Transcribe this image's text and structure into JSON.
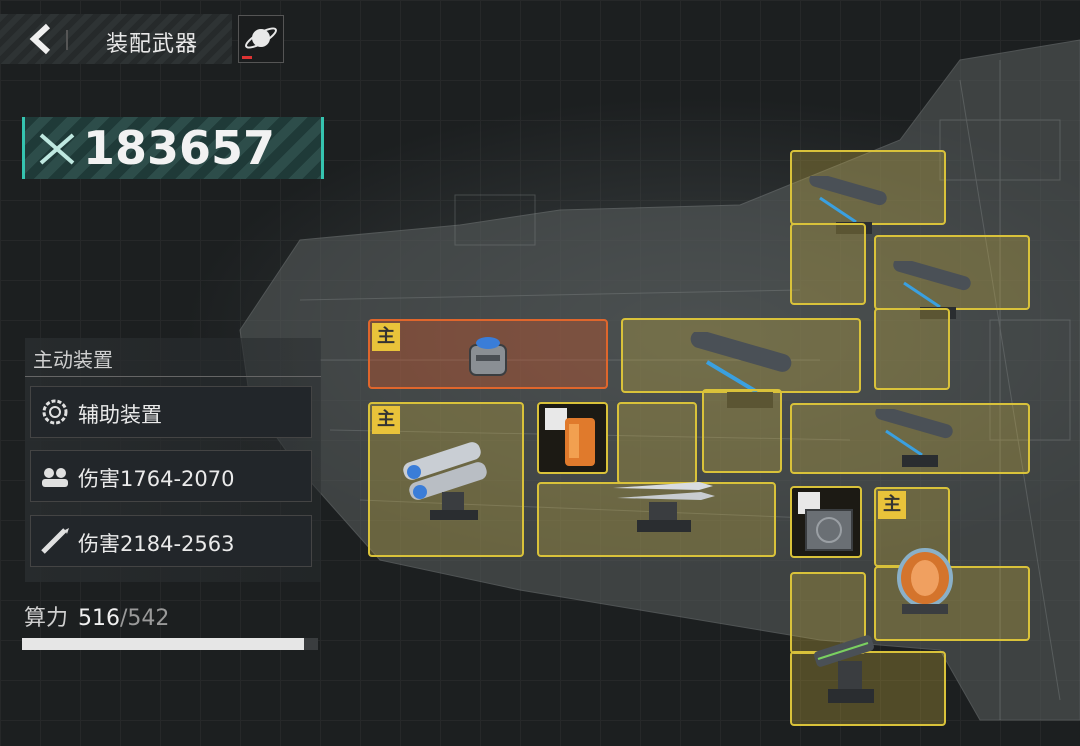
{
  "header": {
    "title": "装配武器",
    "back_icon": "back-arrow-icon",
    "planet_icon": "planet-icon"
  },
  "power": {
    "value": "183657",
    "icon": "crossed-swords-icon"
  },
  "panel": {
    "header": "主动装置",
    "rows": [
      {
        "label": "辅助装置",
        "icon": "gear-target-icon"
      },
      {
        "label": "伤害1764-2070",
        "icon": "squad-icon"
      },
      {
        "label": "伤害2184-2563",
        "icon": "missile-icon"
      }
    ]
  },
  "compute": {
    "label": "算力",
    "current": "516",
    "max": "/542",
    "fraction": 0.952
  },
  "slots": {
    "main_badge": "主"
  },
  "colors": {
    "slot_border": "#d9c23a",
    "slot_fill": "#dcbe3c",
    "main_slot": "#e0662c",
    "power_accent": "#35c4b0"
  }
}
